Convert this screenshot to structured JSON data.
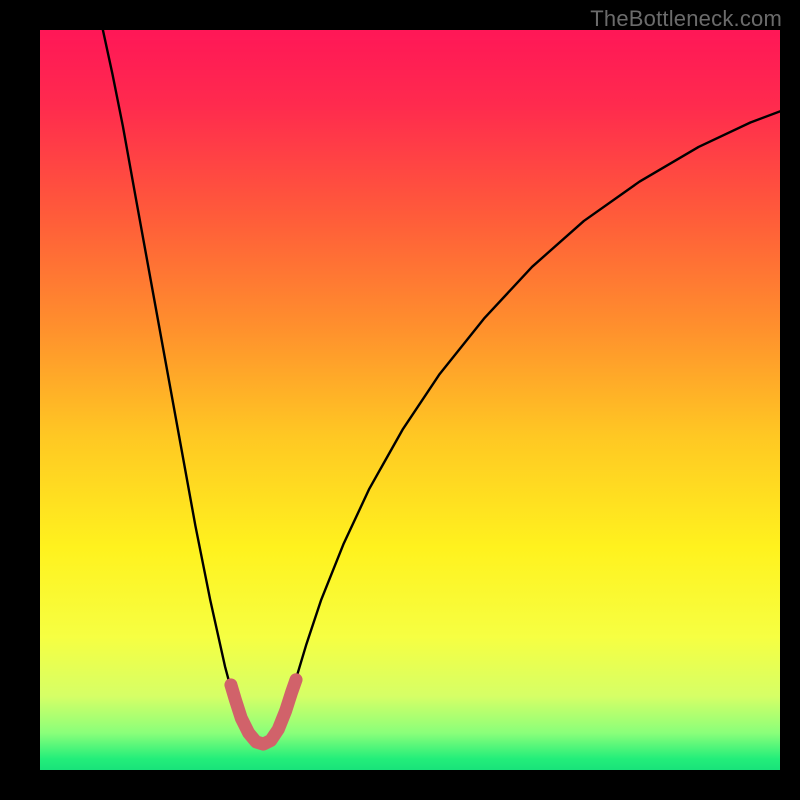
{
  "watermark": "TheBottleneck.com",
  "gradient_stops": [
    {
      "offset": 0.0,
      "color": "#ff1757"
    },
    {
      "offset": 0.1,
      "color": "#ff2a4e"
    },
    {
      "offset": 0.25,
      "color": "#ff5b3a"
    },
    {
      "offset": 0.4,
      "color": "#ff8f2d"
    },
    {
      "offset": 0.55,
      "color": "#ffc823"
    },
    {
      "offset": 0.7,
      "color": "#fff21e"
    },
    {
      "offset": 0.82,
      "color": "#f6ff42"
    },
    {
      "offset": 0.9,
      "color": "#d6ff66"
    },
    {
      "offset": 0.95,
      "color": "#8aff7a"
    },
    {
      "offset": 0.985,
      "color": "#23e e7a"
    },
    {
      "offset": 1.0,
      "color": "#19e37a"
    }
  ],
  "curves": {
    "main_black": [
      {
        "x": 0.085,
        "y": 0.0
      },
      {
        "x": 0.098,
        "y": 0.06
      },
      {
        "x": 0.112,
        "y": 0.13
      },
      {
        "x": 0.13,
        "y": 0.23
      },
      {
        "x": 0.15,
        "y": 0.34
      },
      {
        "x": 0.17,
        "y": 0.45
      },
      {
        "x": 0.19,
        "y": 0.56
      },
      {
        "x": 0.21,
        "y": 0.67
      },
      {
        "x": 0.23,
        "y": 0.77
      },
      {
        "x": 0.25,
        "y": 0.86
      },
      {
        "x": 0.258,
        "y": 0.89
      },
      {
        "x": 0.266,
        "y": 0.91
      },
      {
        "x": 0.28,
        "y": 0.94
      },
      {
        "x": 0.295,
        "y": 0.962
      },
      {
        "x": 0.31,
        "y": 0.962
      },
      {
        "x": 0.322,
        "y": 0.945
      },
      {
        "x": 0.335,
        "y": 0.915
      },
      {
        "x": 0.345,
        "y": 0.88
      },
      {
        "x": 0.36,
        "y": 0.83
      },
      {
        "x": 0.38,
        "y": 0.77
      },
      {
        "x": 0.41,
        "y": 0.695
      },
      {
        "x": 0.445,
        "y": 0.62
      },
      {
        "x": 0.49,
        "y": 0.54
      },
      {
        "x": 0.54,
        "y": 0.465
      },
      {
        "x": 0.6,
        "y": 0.39
      },
      {
        "x": 0.665,
        "y": 0.32
      },
      {
        "x": 0.735,
        "y": 0.258
      },
      {
        "x": 0.81,
        "y": 0.205
      },
      {
        "x": 0.89,
        "y": 0.158
      },
      {
        "x": 0.96,
        "y": 0.125
      },
      {
        "x": 1.0,
        "y": 0.11
      }
    ],
    "valley_red": [
      {
        "x": 0.258,
        "y": 0.885
      },
      {
        "x": 0.264,
        "y": 0.905
      },
      {
        "x": 0.272,
        "y": 0.93
      },
      {
        "x": 0.282,
        "y": 0.95
      },
      {
        "x": 0.292,
        "y": 0.962
      },
      {
        "x": 0.302,
        "y": 0.965
      },
      {
        "x": 0.312,
        "y": 0.96
      },
      {
        "x": 0.322,
        "y": 0.945
      },
      {
        "x": 0.332,
        "y": 0.92
      },
      {
        "x": 0.34,
        "y": 0.895
      },
      {
        "x": 0.346,
        "y": 0.878
      }
    ]
  },
  "chart_data": {
    "type": "line",
    "title": "",
    "xlabel": "",
    "ylabel": "",
    "xlim": [
      0,
      1
    ],
    "ylim": [
      0,
      1
    ],
    "series": [
      {
        "name": "bottleneck-curve",
        "color": "#000000",
        "x": [
          0.085,
          0.098,
          0.112,
          0.13,
          0.15,
          0.17,
          0.19,
          0.21,
          0.23,
          0.25,
          0.258,
          0.266,
          0.28,
          0.295,
          0.31,
          0.322,
          0.335,
          0.345,
          0.36,
          0.38,
          0.41,
          0.445,
          0.49,
          0.54,
          0.6,
          0.665,
          0.735,
          0.81,
          0.89,
          0.96,
          1.0
        ],
        "y": [
          1.0,
          0.94,
          0.87,
          0.77,
          0.66,
          0.55,
          0.44,
          0.33,
          0.23,
          0.14,
          0.11,
          0.09,
          0.06,
          0.038,
          0.038,
          0.055,
          0.085,
          0.12,
          0.17,
          0.23,
          0.305,
          0.38,
          0.46,
          0.535,
          0.61,
          0.68,
          0.742,
          0.795,
          0.842,
          0.875,
          0.89
        ]
      },
      {
        "name": "optimal-region-highlight",
        "color": "#d1626a",
        "x": [
          0.258,
          0.264,
          0.272,
          0.282,
          0.292,
          0.302,
          0.312,
          0.322,
          0.332,
          0.34,
          0.346
        ],
        "y": [
          0.115,
          0.095,
          0.07,
          0.05,
          0.038,
          0.035,
          0.04,
          0.055,
          0.08,
          0.105,
          0.122
        ]
      }
    ],
    "background_gradient": {
      "direction": "vertical",
      "stops": [
        {
          "offset": 0.0,
          "color": "#ff1757"
        },
        {
          "offset": 0.55,
          "color": "#ffc823"
        },
        {
          "offset": 0.82,
          "color": "#f6ff42"
        },
        {
          "offset": 1.0,
          "color": "#19e37a"
        }
      ]
    }
  }
}
